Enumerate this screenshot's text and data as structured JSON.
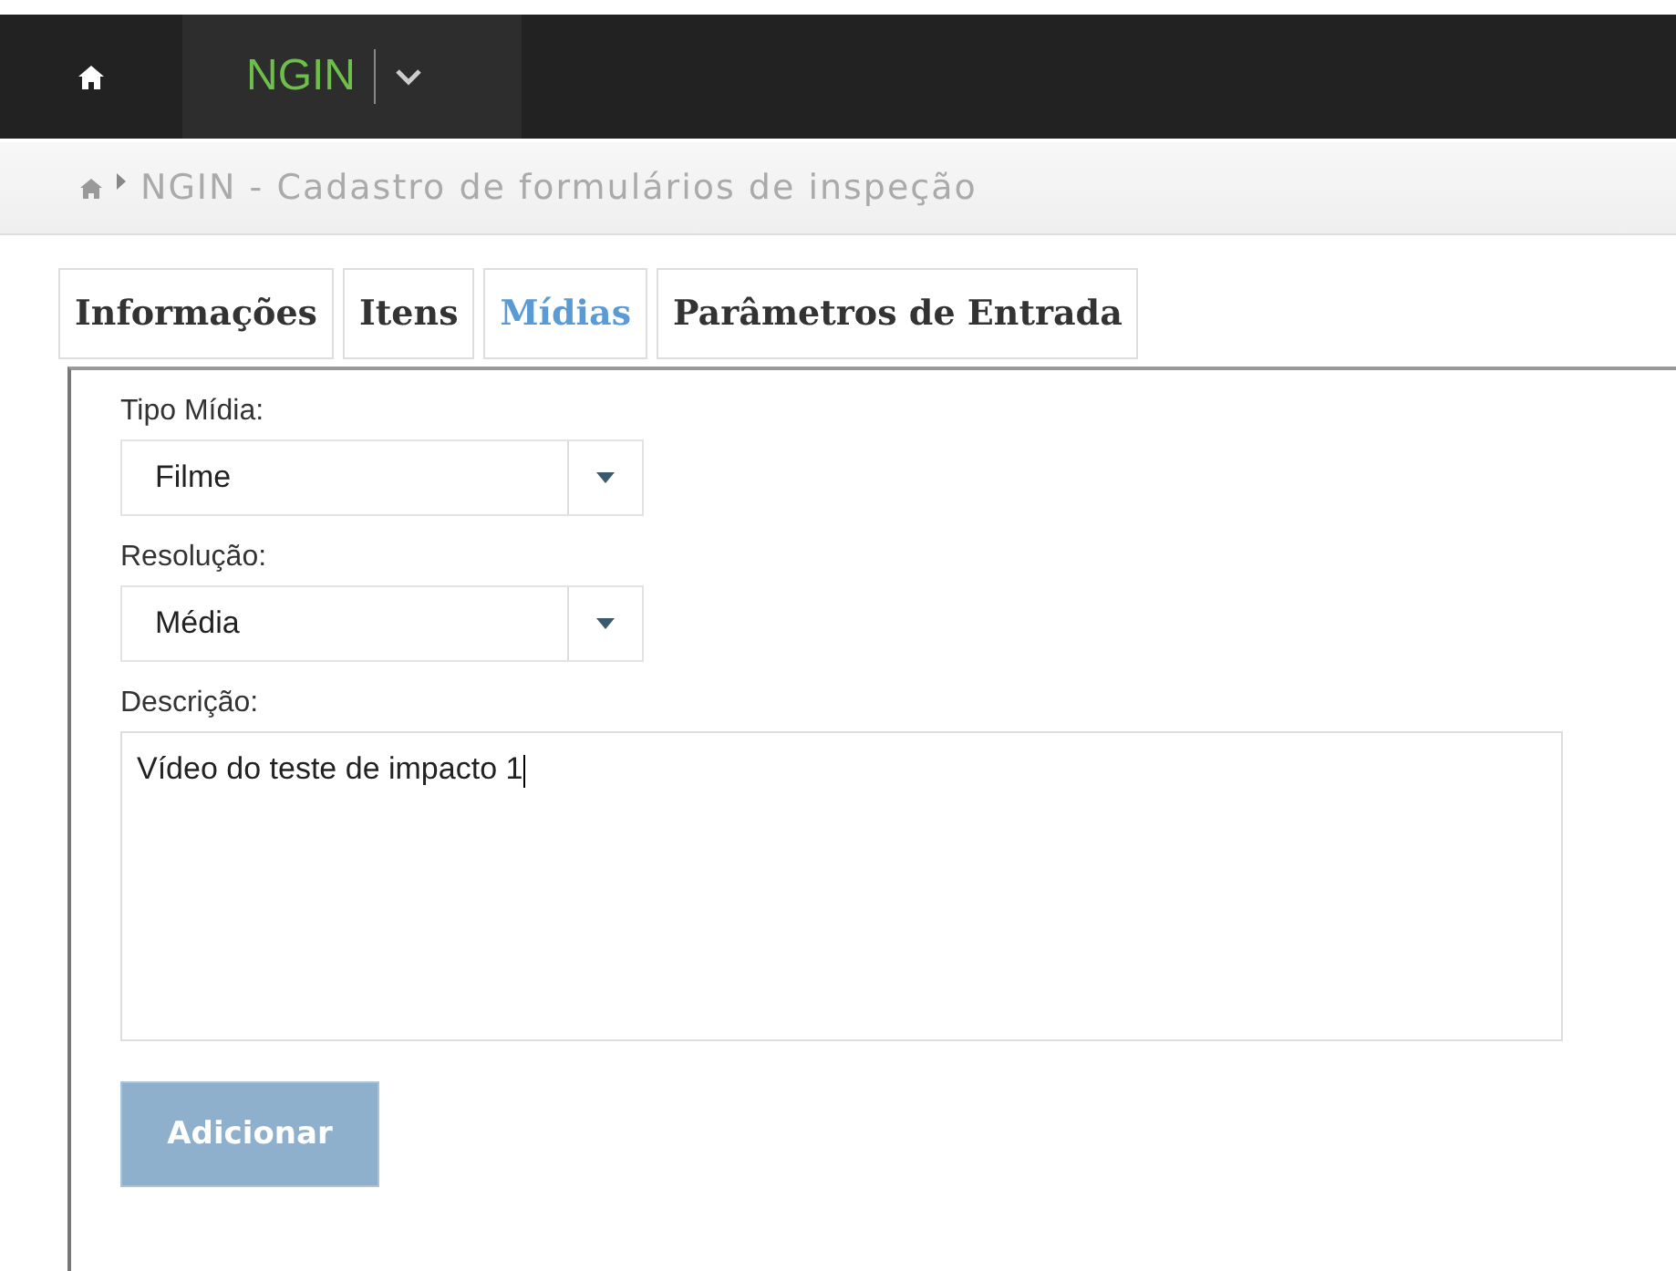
{
  "navbar": {
    "app_name": "NGIN"
  },
  "breadcrumb": {
    "title": "NGIN - Cadastro de formulários de inspeção"
  },
  "tabs": [
    {
      "label": "Informações",
      "selected": false
    },
    {
      "label": "Itens",
      "selected": false
    },
    {
      "label": "Mídias",
      "selected": true
    },
    {
      "label": "Parâmetros de Entrada",
      "selected": false
    }
  ],
  "form": {
    "selects": [
      {
        "label": "Tipo Mídia:",
        "value": "Filme"
      },
      {
        "label": "Resolução:",
        "value": "Média"
      }
    ],
    "description": {
      "label": "Descrição:",
      "value": "Vídeo do teste de impacto 1"
    },
    "add_button": {
      "label": "Adicionar",
      "disabled": true
    }
  }
}
